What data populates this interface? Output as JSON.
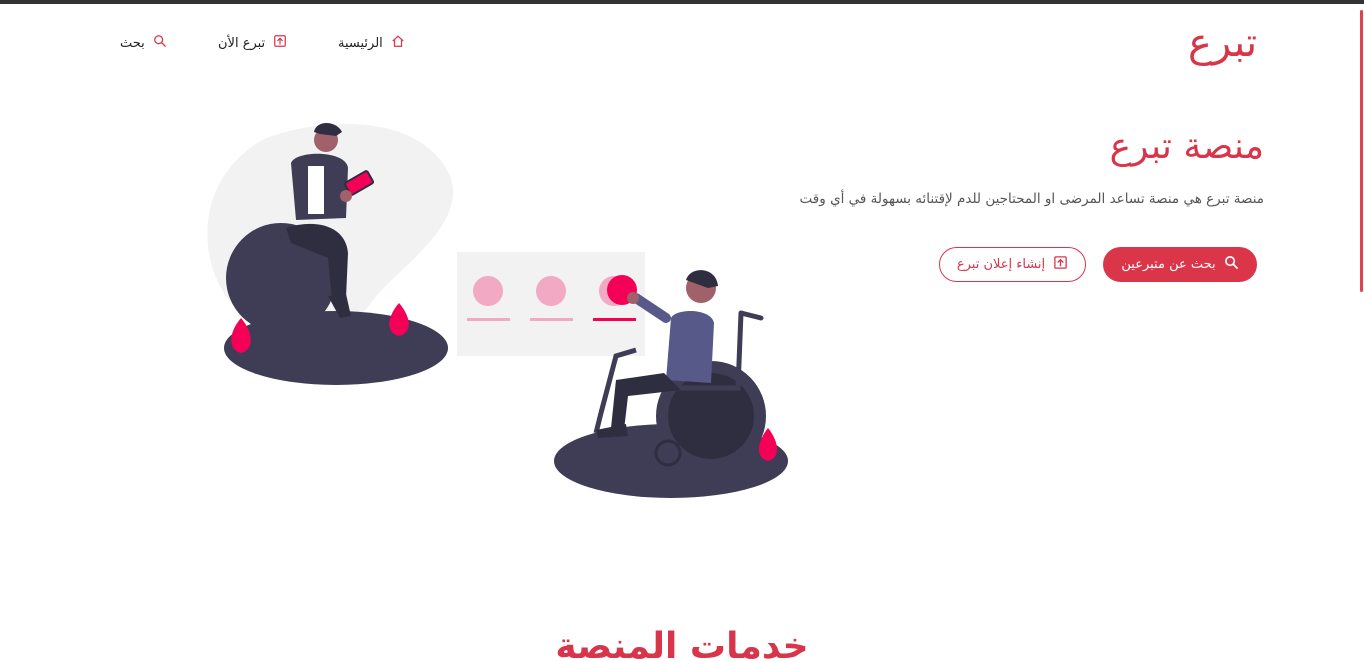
{
  "logo": {
    "text": "تبرع"
  },
  "nav": {
    "home": {
      "label": "الرئيسية",
      "icon": "home-icon"
    },
    "donate_now": {
      "label": "تبرع الأن",
      "icon": "upload-icon"
    },
    "search": {
      "label": "بحث",
      "icon": "search-icon"
    }
  },
  "hero": {
    "title": "منصة تبرع",
    "description": "منصة تبرع هي منصة تساعد المرضى او المحتاجين للدم لإقتنائه بسهولة في أي وقت",
    "primary_button": {
      "label": "بحث عن متبرعين",
      "icon": "search-icon"
    },
    "secondary_button": {
      "label": "إنشاء إعلان تبرع",
      "icon": "upload-icon"
    }
  },
  "section": {
    "title": "خدمات المنصة"
  },
  "colors": {
    "accent": "#db3549",
    "dark": "#3f3d56",
    "pink": "#f50057",
    "light_pink": "#f2a9c4"
  }
}
